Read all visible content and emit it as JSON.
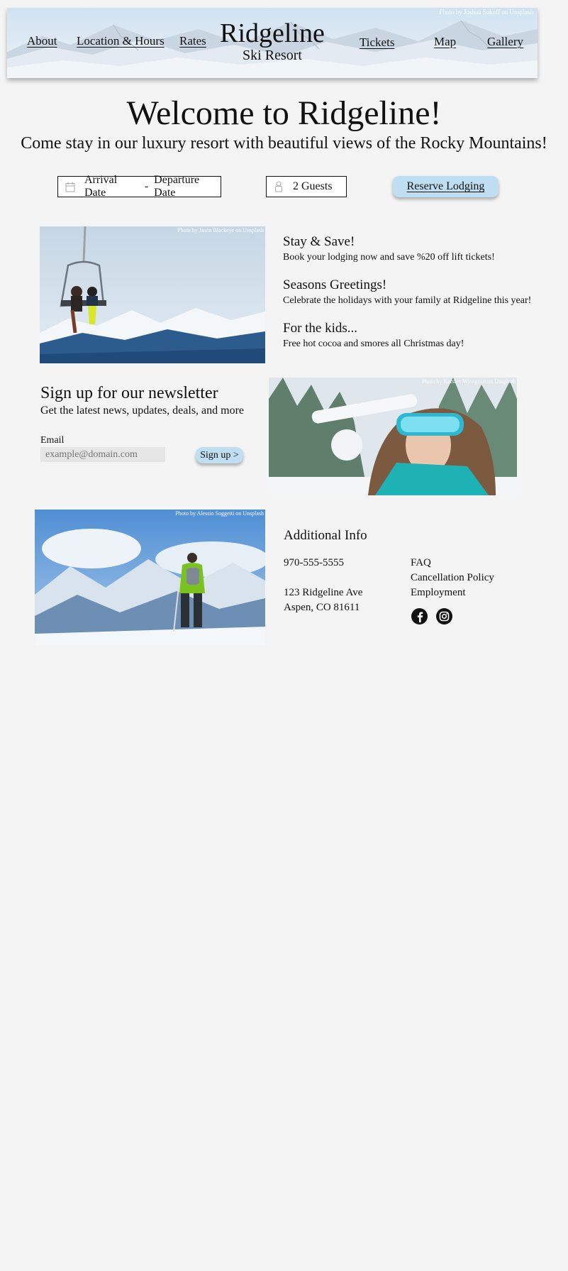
{
  "header": {
    "nav_left": [
      "About",
      "Location & Hours",
      "Rates"
    ],
    "nav_right": [
      "Tickets",
      "Map",
      "Gallery"
    ],
    "brand_title": "Ridgeline",
    "brand_subtitle": "Ski Resort",
    "photo_credit": "Photo by Joshua Sukoff on Unsplash"
  },
  "hero": {
    "title": "Welcome to Ridgeline!",
    "subtitle": "Come stay in our luxury resort with beautiful views of the Rocky Mountains!"
  },
  "booking": {
    "arrival": "Arrival Date",
    "separator": "-",
    "departure": "Departure Date",
    "guests": "2 Guests",
    "reserve_label": "Reserve Lodging",
    "calendar_icon": "calendar-icon",
    "guest_icon": "person-icon"
  },
  "photos": {
    "chairlift_credit": "Photo by Jason Blackeye on Unsplash",
    "goggles_credit": "Photo by Karsten Winegeart on Unsplash",
    "hiker_credit": "Photo by Alessio Soggetti on Unsplash"
  },
  "promos": [
    {
      "title": "Stay & Save!",
      "text": "Book your lodging now and save %20 off lift tickets!"
    },
    {
      "title": "Seasons Greetings!",
      "text": "Celebrate the holidays with your family at Ridgeline this year!"
    },
    {
      "title": "For the kids...",
      "text": "Free hot cocoa and smores all Christmas day!"
    }
  ],
  "newsletter": {
    "title": "Sign up for our newsletter",
    "subtitle": "Get the latest news, updates, deals, and more",
    "email_label": "Email",
    "email_placeholder": "example@domain.com",
    "signup_label": "Sign up >"
  },
  "info": {
    "title": "Additional Info",
    "phone": "970-555-5555",
    "address_line1": "123 Ridgeline Ave",
    "address_line2": "Aspen, CO 81611",
    "links": [
      "FAQ",
      "Cancellation Policy",
      "Employment"
    ],
    "social": [
      "facebook-icon",
      "instagram-icon"
    ]
  },
  "colors": {
    "background": "#f4f4f4",
    "button": "#bfdef2",
    "text": "#111111"
  }
}
